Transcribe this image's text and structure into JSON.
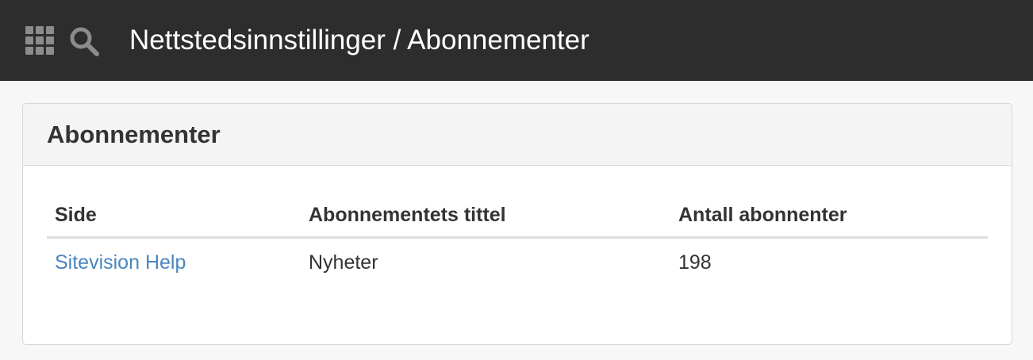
{
  "topbar": {
    "background": "#2d2d2d",
    "apps_icon": "grid-icon",
    "search_icon": "search-icon",
    "title": "Nettstedsinnstillinger / Abonnementer"
  },
  "panel": {
    "title": "Abonnementer",
    "table": {
      "columns": [
        "Side",
        "Abonnementets tittel",
        "Antall abonnenter"
      ],
      "rows": [
        {
          "side": "Sitevision Help",
          "title": "Nyheter",
          "count": "198"
        }
      ]
    }
  },
  "colors": {
    "link": "#4a86c0",
    "text": "#333333",
    "page_background": "#f7f7f7"
  }
}
